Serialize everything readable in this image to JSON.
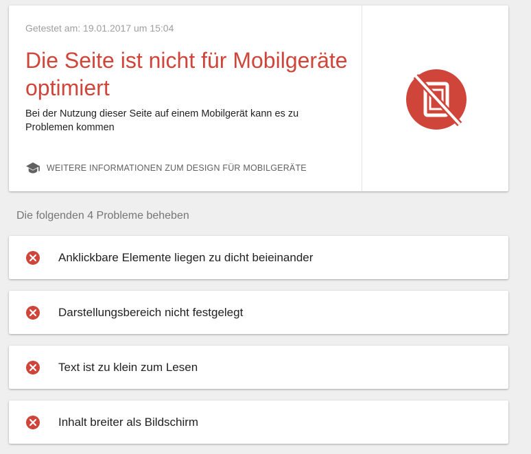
{
  "result": {
    "tested_at": "Getestet am: 19.01.2017 um 15:04",
    "title": "Die Seite ist nicht für Mobilgeräte optimiert",
    "description": "Bei der Nutzung dieser Seite auf einem Mobilgerät kann es zu Problemen kommen",
    "learn_more_label": "WEITERE INFORMATIONEN ZUM DESIGN FÜR MOBILGERÄTE",
    "learn_more_icon": "graduation-cap-icon",
    "status_icon": "not-mobile-friendly-icon"
  },
  "issues_heading": "Die folgenden 4 Probleme beheben",
  "issues": [
    {
      "label": "Anklickbare Elemente liegen zu dicht beieinander",
      "icon": "error-icon"
    },
    {
      "label": "Darstellungsbereich nicht festgelegt",
      "icon": "error-icon"
    },
    {
      "label": "Text ist zu klein zum Lesen",
      "icon": "error-icon"
    },
    {
      "label": "Inhalt breiter als Bildschirm",
      "icon": "error-icon"
    }
  ],
  "colors": {
    "error": "#d0453a",
    "background": "#efefef",
    "card": "#ffffff",
    "muted_text": "#9e9e9e",
    "body_text": "#212121"
  }
}
